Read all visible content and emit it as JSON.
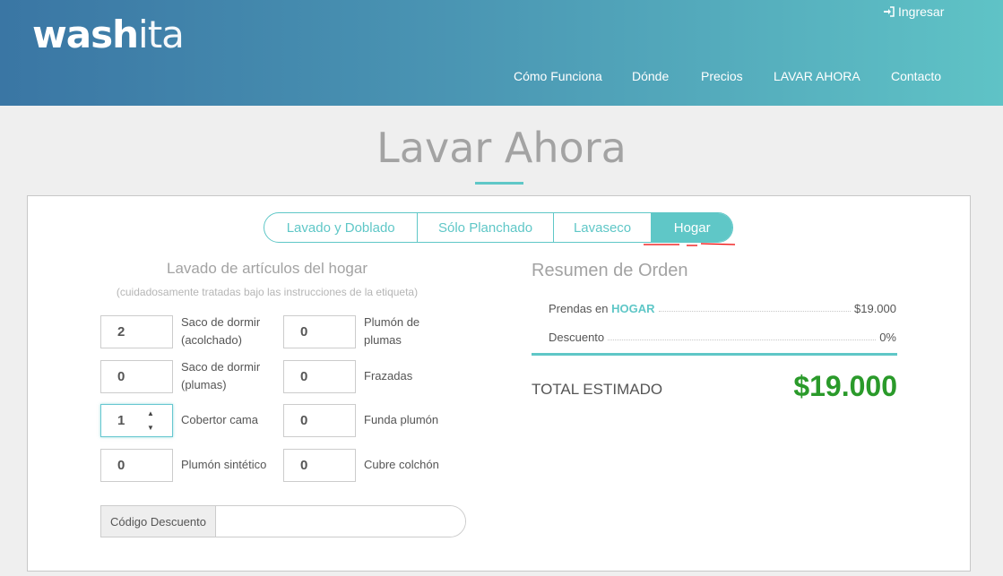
{
  "header": {
    "logo_bold": "wash",
    "logo_light": "ita",
    "login_label": "Ingresar",
    "nav": [
      "Cómo Funciona",
      "Dónde",
      "Precios",
      "LAVAR AHORA",
      "Contacto"
    ]
  },
  "page": {
    "title": "Lavar Ahora"
  },
  "tabs": [
    {
      "label": "Lavado y Doblado"
    },
    {
      "label": "Sólo Planchado"
    },
    {
      "label": "Lavaseco"
    },
    {
      "label": "Hogar",
      "active": true
    }
  ],
  "section": {
    "title": "Lavado de artículos del hogar",
    "subtitle": "(cuidadosamente tratadas bajo las instrucciones de la etiqueta)"
  },
  "items": [
    {
      "qty": "2",
      "label": "Saco de dormir (acolchado)"
    },
    {
      "qty": "0",
      "label": "Plumón de plumas"
    },
    {
      "qty": "0",
      "label": "Saco de dormir (plumas)"
    },
    {
      "qty": "0",
      "label": "Frazadas"
    },
    {
      "qty": "1",
      "label": "Cobertor cama"
    },
    {
      "qty": "0",
      "label": "Funda plumón"
    },
    {
      "qty": "0",
      "label": "Plumón sintético"
    },
    {
      "qty": "0",
      "label": "Cubre colchón"
    }
  ],
  "discount": {
    "label": "Código Descuento",
    "value": ""
  },
  "summary": {
    "title": "Resumen de Orden",
    "garments_label": "Prendas en",
    "garments_category": "HOGAR",
    "garments_value": "$19.000",
    "discount_label": "Descuento",
    "discount_value": "0%",
    "total_label": "TOTAL ESTIMADO",
    "total_value": "$19.000"
  },
  "colors": {
    "accent": "#5fc7c7",
    "total": "#2a9a2a",
    "header_start": "#3a76a4",
    "header_end": "#5fc3c6"
  }
}
